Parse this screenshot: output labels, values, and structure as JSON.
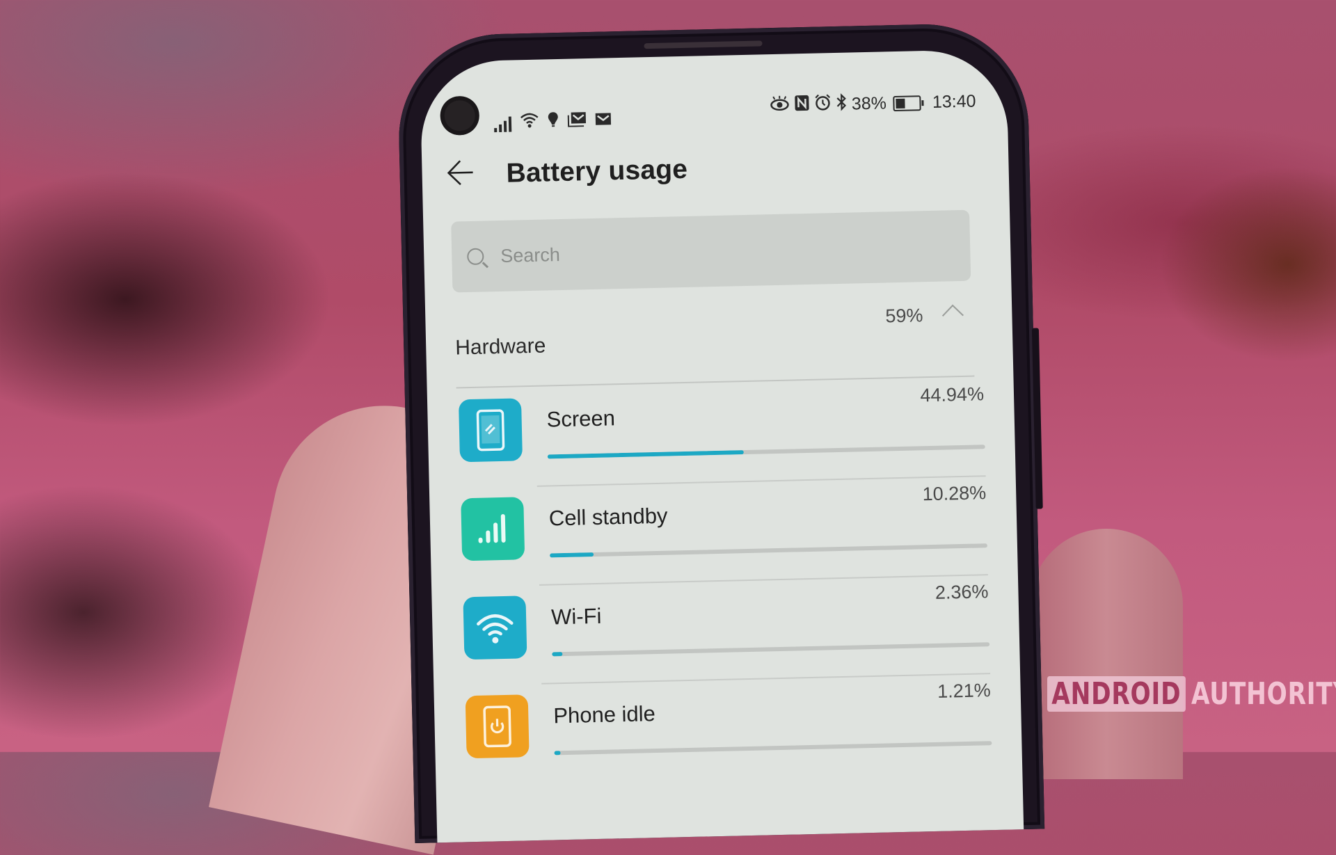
{
  "status_bar": {
    "left_icons": [
      "signal-icon",
      "wifi-icon",
      "location-icon",
      "gmail-stack-icon",
      "gmail-icon"
    ],
    "right_icons": [
      "eye-comfort-icon",
      "nfc-icon",
      "alarm-icon",
      "bluetooth-icon"
    ],
    "battery_percent": "38%",
    "battery_level": 0.38,
    "time": "13:40"
  },
  "header": {
    "back_icon": "arrow-left-icon",
    "title": "Battery usage"
  },
  "search": {
    "placeholder": "Search",
    "value": ""
  },
  "section": {
    "title": "Hardware",
    "percent": "59%",
    "expanded": true
  },
  "items": [
    {
      "label": "Screen",
      "percent": "44.94%",
      "bar_fraction": 0.449,
      "icon": "screen-icon",
      "color": "#1eacc9"
    },
    {
      "label": "Cell standby",
      "percent": "10.28%",
      "bar_fraction": 0.1,
      "icon": "cell-signal-icon",
      "color": "#22c2a3"
    },
    {
      "label": "Wi-Fi",
      "percent": "2.36%",
      "bar_fraction": 0.024,
      "icon": "wifi-icon",
      "color": "#1eacc9"
    },
    {
      "label": "Phone idle",
      "percent": "1.21%",
      "bar_fraction": 0.012,
      "icon": "phone-idle-icon",
      "color": "#f0a020"
    }
  ],
  "watermark": {
    "part1": "ANDROID",
    "part2": "AUTHORITY"
  },
  "colors": {
    "progress": "#1ca8c4",
    "screen_bg": "#dfe3df"
  }
}
